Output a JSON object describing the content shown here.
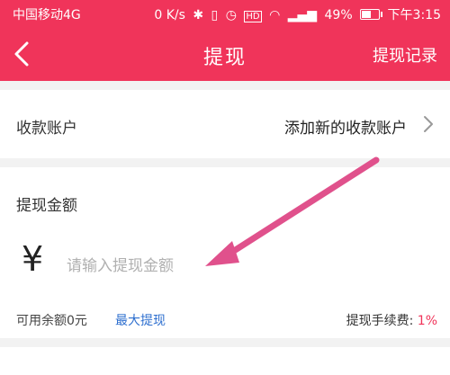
{
  "status_bar": {
    "carrier": "中国移动4G",
    "network_speed": "0 K/s",
    "battery": "49%",
    "time": "下午3:15"
  },
  "nav": {
    "title": "提现",
    "action": "提现记录"
  },
  "account": {
    "label": "收款账户",
    "value": "添加新的收款账户"
  },
  "amount": {
    "title": "提现金额",
    "currency_symbol": "¥",
    "placeholder": "请输入提现金额",
    "value": ""
  },
  "footer": {
    "balance": "可用余额0元",
    "max_label": "最大提现",
    "fee_label": "提现手续费:",
    "fee_value": "1%"
  },
  "colors": {
    "brand": "#f0345a",
    "link": "#2e6fcf",
    "annotation_arrow": "#e0518c"
  }
}
